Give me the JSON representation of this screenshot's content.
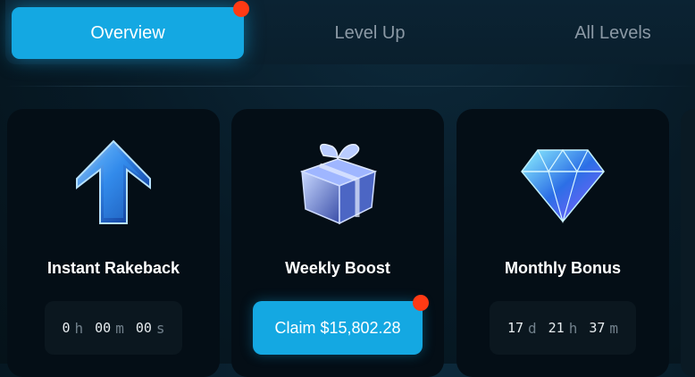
{
  "tabs": [
    {
      "label": "Overview",
      "active": true
    },
    {
      "label": "Level Up",
      "active": false
    },
    {
      "label": "All Levels",
      "active": false
    }
  ],
  "cards": [
    {
      "title": "Instant Rakeback",
      "icon": "arrow-up-icon",
      "timer": [
        {
          "value": "0",
          "unit": "h"
        },
        {
          "value": "00",
          "unit": "m"
        },
        {
          "value": "00",
          "unit": "s"
        }
      ]
    },
    {
      "title": "Weekly Boost",
      "icon": "gift-box-icon",
      "button_label": "Claim $15,802.28"
    },
    {
      "title": "Monthly Bonus",
      "icon": "diamond-icon",
      "timer": [
        {
          "value": "17",
          "unit": "d"
        },
        {
          "value": "21",
          "unit": "h"
        },
        {
          "value": "37",
          "unit": "m"
        }
      ]
    }
  ],
  "colors": {
    "accent": "#14a8e2",
    "notification": "#ff3a14",
    "card_bg": "#040e16",
    "page_bg": "#071a26"
  }
}
